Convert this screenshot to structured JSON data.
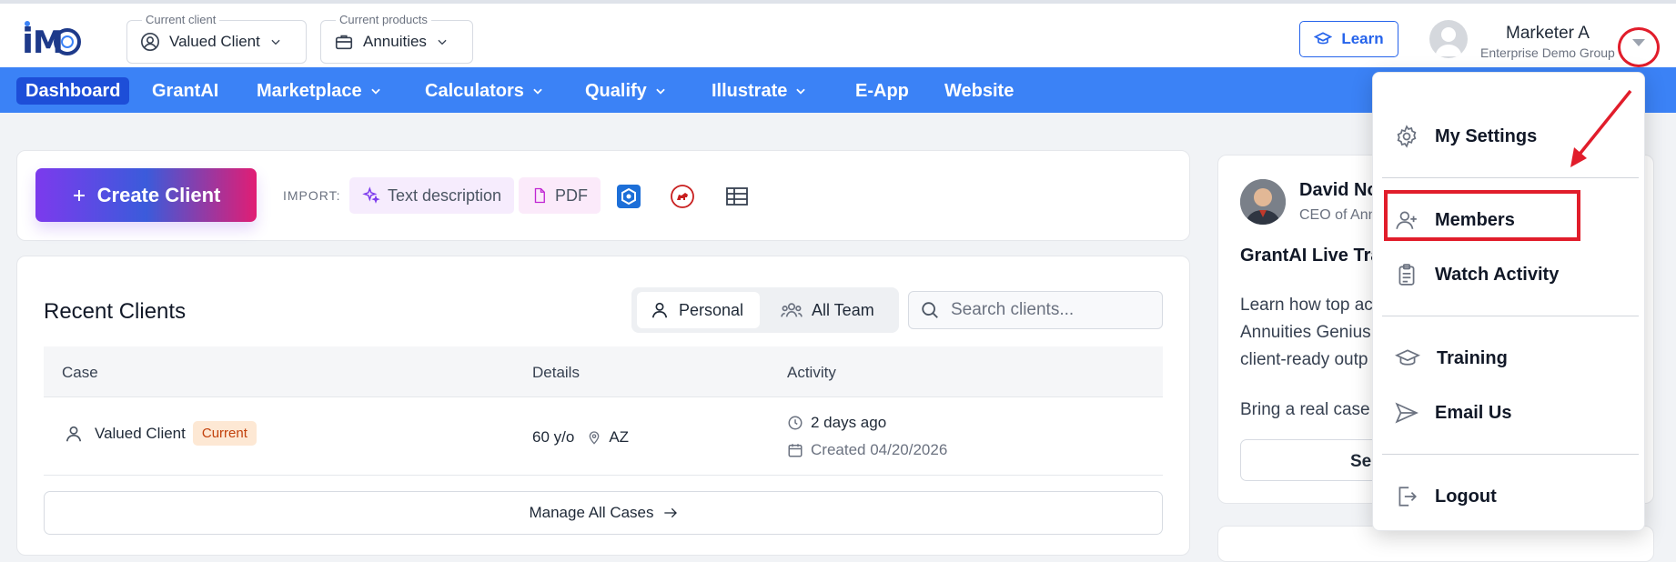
{
  "header": {
    "client_caption": "Current client",
    "client_value": "Valued Client",
    "products_caption": "Current products",
    "products_value": "Annuities",
    "learn_label": "Learn",
    "user_name": "Marketer A",
    "user_org": "Enterprise Demo Group"
  },
  "nav": {
    "items": [
      {
        "label": "Dashboard"
      },
      {
        "label": "GrantAI"
      },
      {
        "label": "Marketplace"
      },
      {
        "label": "Calculators"
      },
      {
        "label": "Qualify"
      },
      {
        "label": "Illustrate"
      },
      {
        "label": "E-App"
      },
      {
        "label": "Website"
      }
    ]
  },
  "actions": {
    "create_label": "Create Client",
    "import_label": "IMPORT:",
    "text_description": "Text description",
    "pdf": "PDF"
  },
  "recent": {
    "title": "Recent Clients",
    "toggle_personal": "Personal",
    "toggle_team": "All Team",
    "search_placeholder": "Search clients...",
    "columns": [
      "Case",
      "Details",
      "Activity"
    ],
    "rows": [
      {
        "name": "Valued Client",
        "badge": "Current",
        "age": "60 y/o",
        "state": "AZ",
        "last_activity": "2 days ago",
        "created": "Created 04/20/2026"
      }
    ],
    "manage_label": "Manage All Cases"
  },
  "side": {
    "person_name": "David No",
    "person_role": "CEO of Ann",
    "heading": "GrantAI Live Tra",
    "para_1": "Learn how top ac",
    "para_2": "Annuities Genius",
    "para_3": "client-ready outp",
    "para_4": "Bring a real case",
    "button_label": "Se"
  },
  "dropdown": {
    "items": [
      {
        "label": "My Settings"
      },
      {
        "label": "Members"
      },
      {
        "label": "Watch Activity"
      },
      {
        "label": "Training"
      },
      {
        "label": "Email Us"
      },
      {
        "label": "Logout"
      }
    ]
  },
  "colors": {
    "nav_bg": "#3b82f6",
    "accent": "#2563eb",
    "highlight": "#e11d2b"
  }
}
